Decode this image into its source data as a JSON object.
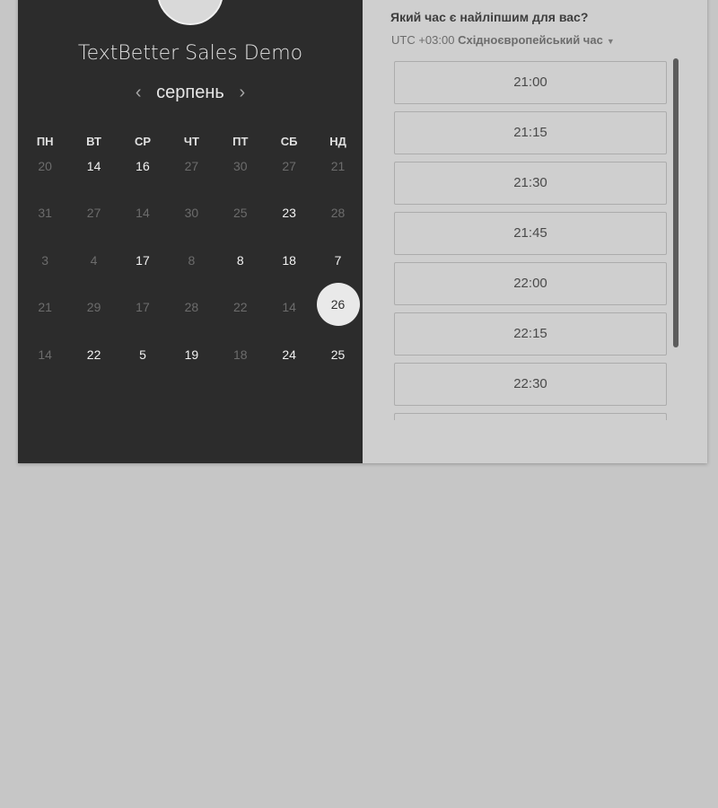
{
  "event": {
    "title": "TextBetter Sales Demo"
  },
  "calendar": {
    "month_label": "серпень",
    "prev_arrow": "‹",
    "next_arrow": "›",
    "weekdays": [
      "ПН",
      "ВТ",
      "СР",
      "ЧТ",
      "ПТ",
      "СБ",
      "НД"
    ],
    "weeks": [
      [
        {
          "d": "20",
          "available": false
        },
        {
          "d": "14",
          "available": true
        },
        {
          "d": "16",
          "available": true
        },
        {
          "d": "27",
          "available": false
        },
        {
          "d": "30",
          "available": false
        },
        {
          "d": "27",
          "available": false
        },
        {
          "d": "21",
          "available": false
        }
      ],
      [
        {
          "d": "31",
          "available": false
        },
        {
          "d": "27",
          "available": false
        },
        {
          "d": "14",
          "available": false
        },
        {
          "d": "30",
          "available": false
        },
        {
          "d": "25",
          "available": false
        },
        {
          "d": "23",
          "available": true
        },
        {
          "d": "28",
          "available": false
        }
      ],
      [
        {
          "d": "3",
          "available": false
        },
        {
          "d": "4",
          "available": false
        },
        {
          "d": "17",
          "available": true
        },
        {
          "d": "8",
          "available": false
        },
        {
          "d": "8",
          "available": true
        },
        {
          "d": "18",
          "available": true
        },
        {
          "d": "7",
          "available": true
        }
      ],
      [
        {
          "d": "21",
          "available": false
        },
        {
          "d": "29",
          "available": false
        },
        {
          "d": "17",
          "available": false
        },
        {
          "d": "28",
          "available": false
        },
        {
          "d": "22",
          "available": false
        },
        {
          "d": "14",
          "available": false
        },
        {
          "d": "26",
          "available": true,
          "selected": true
        }
      ],
      [
        {
          "d": "14",
          "available": false
        },
        {
          "d": "22",
          "available": true
        },
        {
          "d": "5",
          "available": true
        },
        {
          "d": "19",
          "available": true
        },
        {
          "d": "18",
          "available": false
        },
        {
          "d": "24",
          "available": true
        },
        {
          "d": "25",
          "available": true
        }
      ]
    ]
  },
  "times": {
    "question": "Який час є найліпшим для вас?",
    "timezone_offset": "UTC +03:00",
    "timezone_name": "Східноєвропейський час",
    "timezone_caret": "▼",
    "slots": [
      "21:00",
      "21:15",
      "21:30",
      "21:45",
      "22:00",
      "22:15",
      "22:30",
      ""
    ]
  },
  "colors": {
    "page_bg": "#c6c6c6",
    "calendar_bg": "#2c2c2c",
    "selected_day_bg": "#e9e9e9",
    "slot_border": "#acacac"
  },
  "icons": {
    "avatar": "logo-avatar-icon",
    "scroll": "scrollbar"
  }
}
